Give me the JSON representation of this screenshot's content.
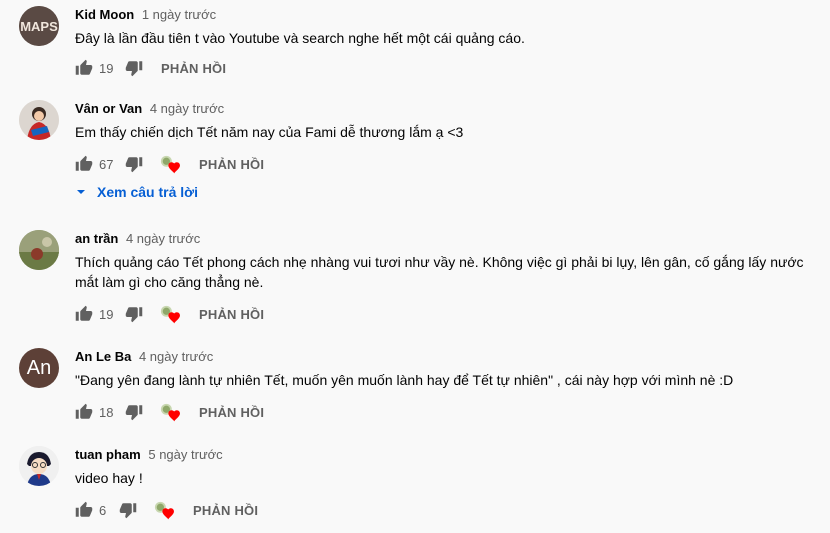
{
  "comments": [
    {
      "author": "Kid Moon",
      "time": "1 ngày trước",
      "text": "Đây là lần đầu tiên t vào Youtube và search nghe hết một cái quảng cáo.",
      "likes": "19",
      "reply": "PHẢN HỒI",
      "avatar_text": "MAPS",
      "hearted": false
    },
    {
      "author": "Vân or Van",
      "time": "4 ngày trước",
      "text": "Em thấy chiến dịch Tết năm nay của Fami dễ thương lắm ạ <3",
      "likes": "67",
      "reply": "PHẢN HỒI",
      "hearted": true,
      "view_replies": "Xem câu trả lời"
    },
    {
      "author": "an trần",
      "time": "4 ngày trước",
      "text": "Thích quảng cáo Tết phong cách nhẹ nhàng vui tươi như vầy nè. Không việc gì phải bi lụy, lên gân, cố gắng lấy nước mắt làm gì cho căng thẳng nè.",
      "likes": "19",
      "reply": "PHẢN HỒI",
      "hearted": true
    },
    {
      "author": "An Le Ba",
      "time": "4 ngày trước",
      "text": "\"Đang yên đang lành tự nhiên Tết, muốn yên muốn lành hay để Tết tự nhiên\" , cái này hợp với mình nè :D",
      "likes": "18",
      "reply": "PHẢN HỒI",
      "avatar_text": "An",
      "hearted": true
    },
    {
      "author": "tuan pham",
      "time": "5 ngày trước",
      "text": "video hay !",
      "likes": "6",
      "reply": "PHẢN HỒI",
      "hearted": true
    }
  ],
  "colors": {
    "accent": "#065fd4",
    "heart": "#ff0000",
    "avatar_an": "#5d4037"
  }
}
